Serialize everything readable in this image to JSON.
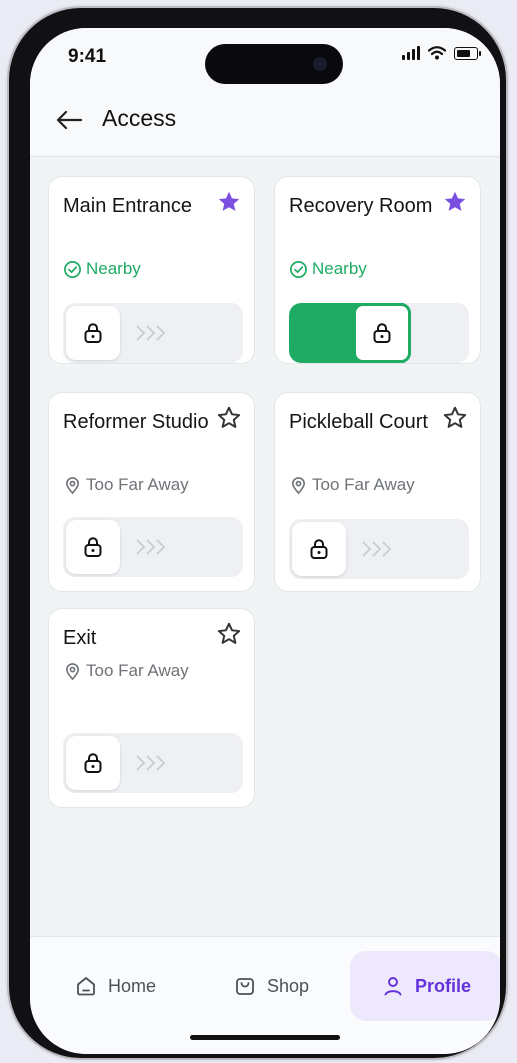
{
  "status_bar": {
    "time": "9:41"
  },
  "header": {
    "title": "Access"
  },
  "colors": {
    "accent": "#6432d8",
    "success": "#1fab64",
    "star": "#7b4fe0"
  },
  "cards": [
    {
      "title": "Main Entrance",
      "favorite": true,
      "status": "Nearby",
      "status_icon": "check-circle-icon",
      "unlocked": false
    },
    {
      "title": "Recovery Room",
      "favorite": true,
      "status": "Nearby",
      "status_icon": "check-circle-icon",
      "unlocked": true
    },
    {
      "title": "Reformer Studio",
      "favorite": false,
      "status": "Too Far Away",
      "status_icon": "location-pin-icon",
      "unlocked": false
    },
    {
      "title": "Pickleball Court",
      "favorite": false,
      "status": "Too Far Away",
      "status_icon": "location-pin-icon",
      "unlocked": false
    },
    {
      "title": "Exit",
      "favorite": false,
      "status": "Too Far Away",
      "status_icon": "location-pin-icon",
      "unlocked": false
    }
  ],
  "nav": {
    "items": [
      {
        "label": "Home",
        "icon": "home-icon",
        "active": false
      },
      {
        "label": "Shop",
        "icon": "shop-icon",
        "active": false
      },
      {
        "label": "Profile",
        "icon": "profile-icon",
        "active": true
      }
    ]
  }
}
